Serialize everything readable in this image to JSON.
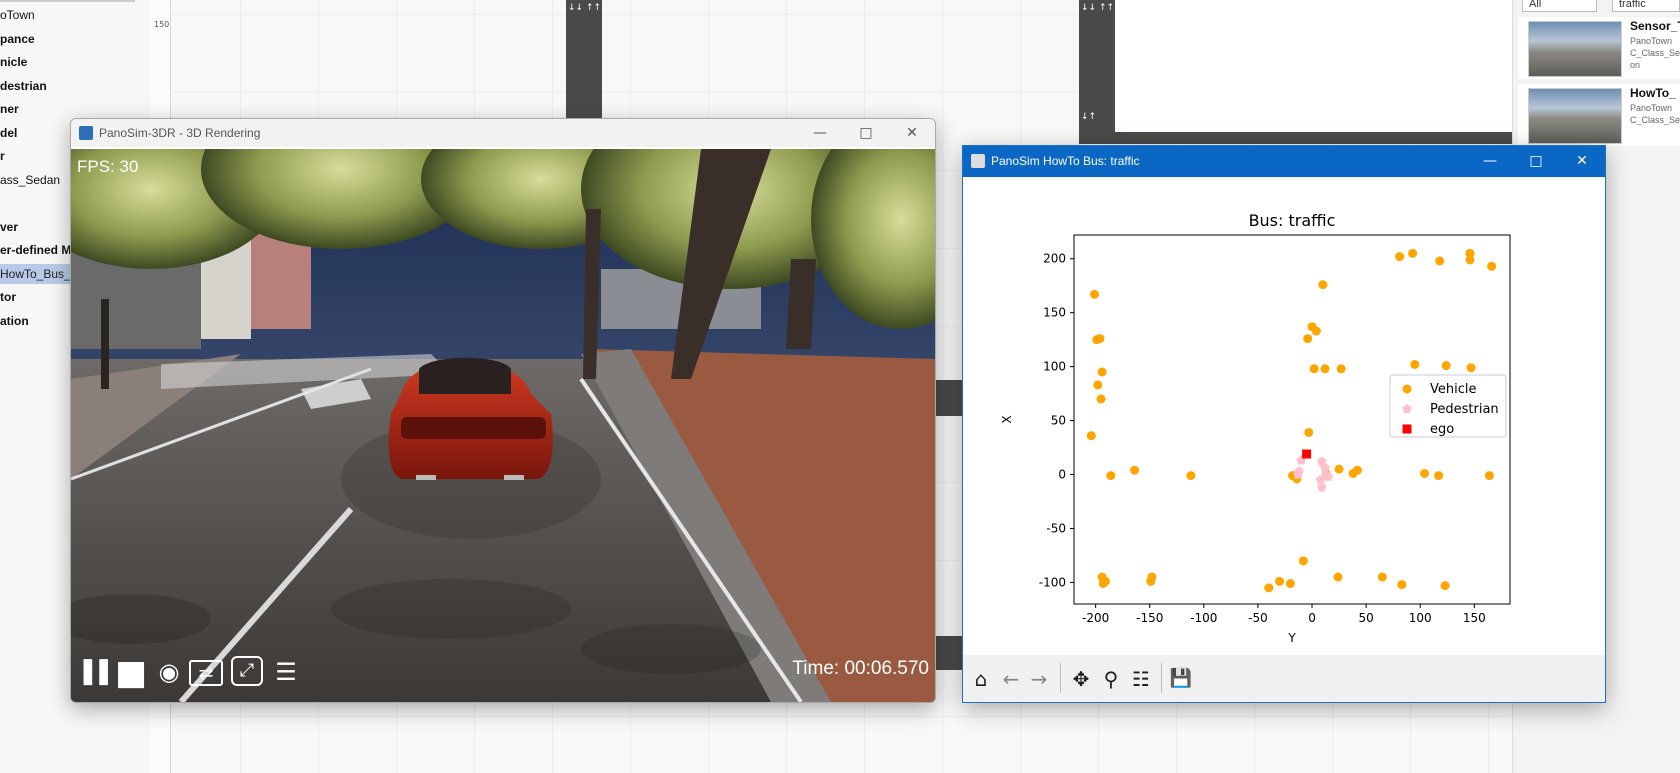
{
  "left_panel": {
    "items": [
      {
        "label": "oTown",
        "bold": false
      },
      {
        "label": "pance",
        "bold": true
      },
      {
        "label": "nicle",
        "bold": true
      },
      {
        "label": "destrian",
        "bold": true
      },
      {
        "label": "ner",
        "bold": true
      },
      {
        "label": "del",
        "bold": true
      },
      {
        "label": "r",
        "bold": true
      },
      {
        "label": "ass_Sedan",
        "bold": false
      },
      {
        "label": "",
        "bold": false
      },
      {
        "label": "ver",
        "bold": true
      },
      {
        "label": "er-defined M",
        "bold": true
      },
      {
        "label": "HowTo_Bus_t",
        "bold": false,
        "selected": true
      },
      {
        "label": "tor",
        "bold": true
      },
      {
        "label": "ation",
        "bold": true
      }
    ]
  },
  "canvas": {
    "ruler_label": "150",
    "road_labels": [
      "↓↓ ↑↑",
      "↓↓ ↑↑",
      "↓↑"
    ]
  },
  "right_panel": {
    "filter_value": "All",
    "search_value": "traffic",
    "results": [
      {
        "title": "Sensor_T",
        "sub": "PanoTown\nC_Class_Se\non"
      },
      {
        "title": "HowTo_",
        "sub": "PanoTown\nC_Class_Se"
      }
    ]
  },
  "render_window": {
    "title": "PanoSim-3DR - 3D Rendering",
    "fps_text": "FPS: 30",
    "time_text": "Time: 00:06.570",
    "controls": {
      "pause": "❚❚",
      "stop": "■",
      "camera": "◉",
      "swap": "⇄",
      "fullscreen": "⤢",
      "menu": "☰"
    }
  },
  "plot_window": {
    "title": "PanoSim HowTo Bus: traffic",
    "toolbar": {
      "home": "⌂",
      "back": "←",
      "forward": "→",
      "pan": "✥",
      "zoom": "⚲",
      "configure": "☷",
      "save": "💾"
    }
  },
  "window_buttons": {
    "minimize": "—",
    "maximize": "□",
    "close": "✕"
  },
  "colors": {
    "vehicle": "#ffa500",
    "pedestrian": "#ffc0cb",
    "ego": "#ff0000",
    "titlebar_active": "#0a67c4"
  },
  "chart_data": {
    "type": "scatter",
    "title": "Bus: traffic",
    "xlabel": "Y",
    "ylabel": "X",
    "xlim": [
      -220,
      183
    ],
    "ylim": [
      -120,
      222
    ],
    "xticks": [
      -200,
      -150,
      -100,
      -50,
      0,
      50,
      100,
      150
    ],
    "yticks": [
      -100,
      -50,
      0,
      50,
      100,
      150,
      200
    ],
    "legend_position": "center right",
    "series": [
      {
        "name": "Vehicle",
        "marker": "circle",
        "color": "#ffa500",
        "points": [
          [
            -201,
            167
          ],
          [
            -199,
            125
          ],
          [
            -196,
            126
          ],
          [
            -194,
            95
          ],
          [
            -198,
            83
          ],
          [
            -195,
            70
          ],
          [
            -204,
            36
          ],
          [
            -186,
            -1
          ],
          [
            -164,
            4
          ],
          [
            -112,
            -1
          ],
          [
            -194,
            -95
          ],
          [
            -193,
            -101
          ],
          [
            -191,
            -99
          ],
          [
            -148,
            -95
          ],
          [
            -149,
            -99
          ],
          [
            -40,
            -105
          ],
          [
            -30,
            -99
          ],
          [
            -20,
            -101
          ],
          [
            -8,
            -80
          ],
          [
            -18,
            -1
          ],
          [
            -14,
            -4
          ],
          [
            -3,
            39
          ],
          [
            0,
            137
          ],
          [
            4,
            133
          ],
          [
            -4,
            126
          ],
          [
            10,
            176
          ],
          [
            2,
            98
          ],
          [
            12,
            98
          ],
          [
            27,
            98
          ],
          [
            13,
            1
          ],
          [
            25,
            5
          ],
          [
            38,
            1
          ],
          [
            42,
            4
          ],
          [
            24,
            -95
          ],
          [
            65,
            -95
          ],
          [
            83,
            -102
          ],
          [
            123,
            -103
          ],
          [
            81,
            202
          ],
          [
            93,
            205
          ],
          [
            118,
            198
          ],
          [
            146,
            205
          ],
          [
            146,
            199
          ],
          [
            166,
            193
          ],
          [
            95,
            102
          ],
          [
            124,
            101
          ],
          [
            147,
            99
          ],
          [
            104,
            1
          ],
          [
            117,
            -1
          ],
          [
            164,
            -1
          ]
        ]
      },
      {
        "name": "Pedestrian",
        "marker": "pentagon",
        "color": "#ffc0cb",
        "points": [
          [
            -13,
            0
          ],
          [
            -12,
            3
          ],
          [
            -10,
            13
          ],
          [
            9,
            12
          ],
          [
            12,
            6
          ],
          [
            13,
            0
          ],
          [
            9,
            -12
          ],
          [
            8,
            -5
          ],
          [
            15,
            -2
          ]
        ]
      },
      {
        "name": "ego",
        "marker": "square",
        "color": "#ff0000",
        "points": [
          [
            -5,
            19
          ]
        ]
      }
    ]
  }
}
